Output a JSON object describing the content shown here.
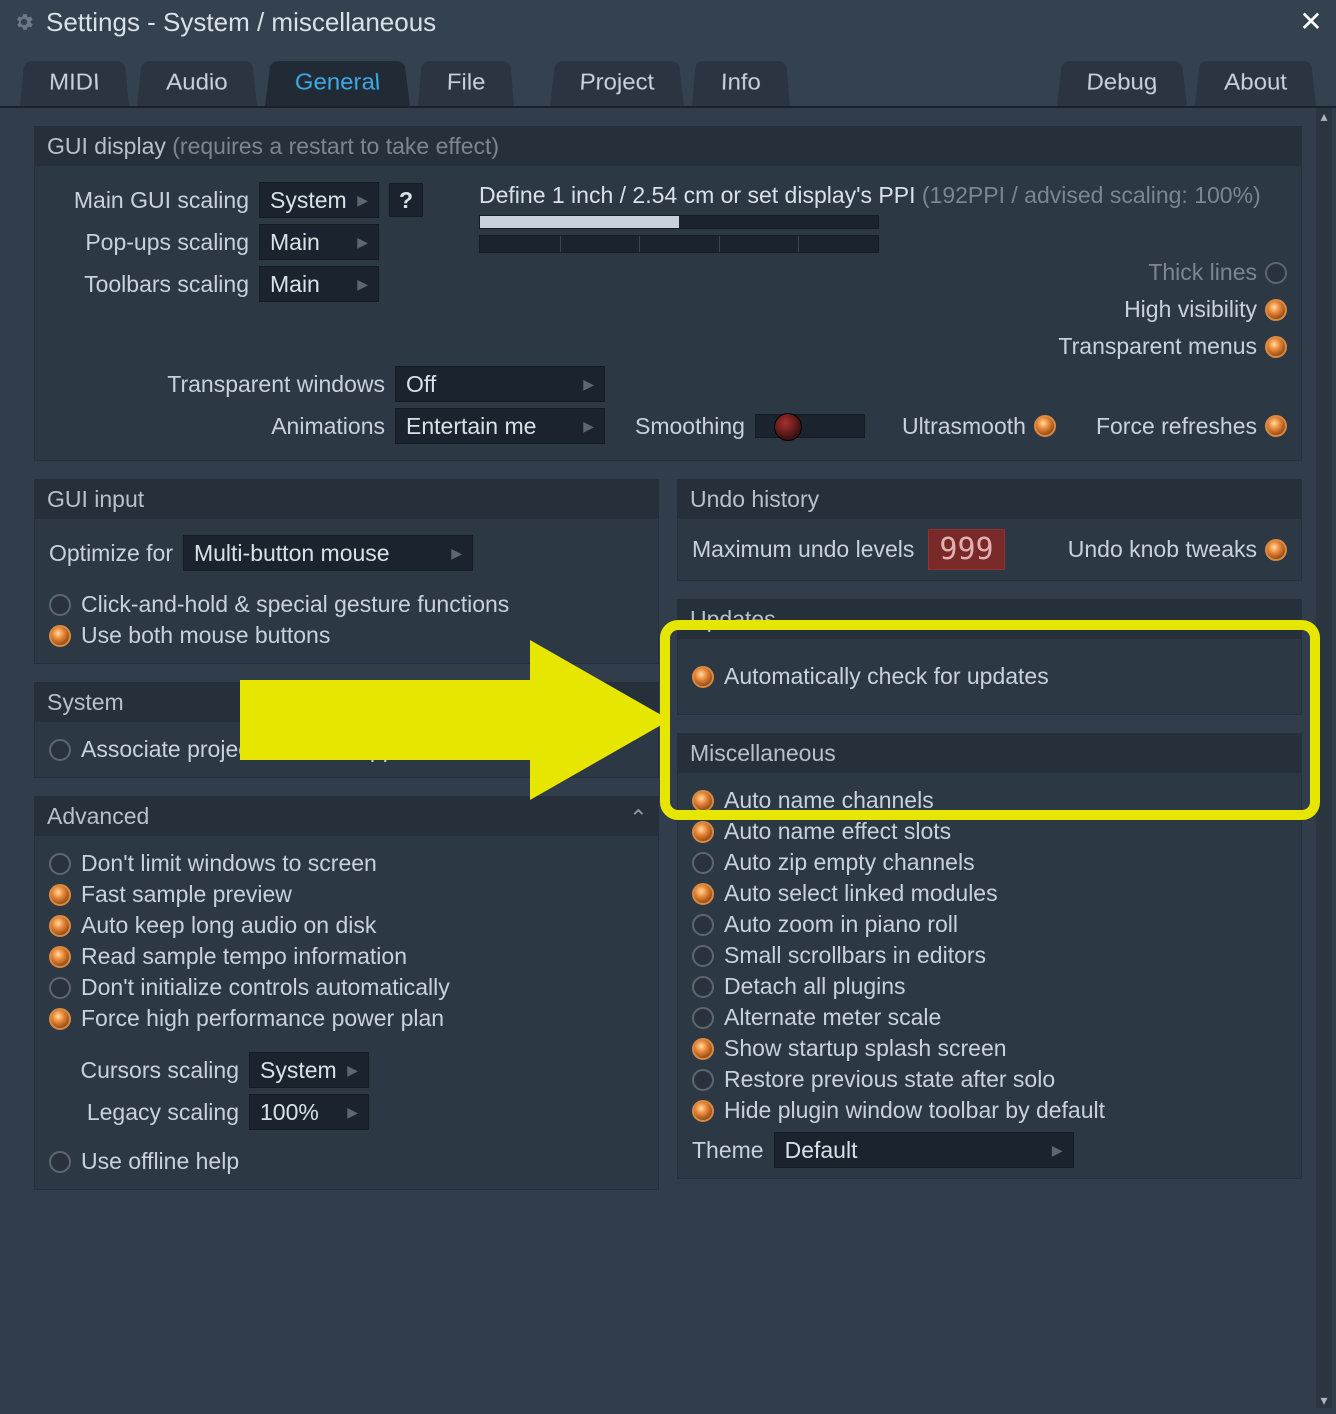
{
  "window": {
    "title": "Settings - System / miscellaneous"
  },
  "tabs": [
    "MIDI",
    "Audio",
    "General",
    "File",
    "Project",
    "Info",
    "Debug",
    "About"
  ],
  "active_tab": "General",
  "gui_display": {
    "title": "GUI display",
    "note": "(requires a restart to take effect)",
    "main_scaling_label": "Main GUI scaling",
    "main_scaling_value": "System",
    "help": "?",
    "define_text": "Define 1 inch / 2.54 cm or set display's PPI",
    "ppi_hint": "(192PPI / advised scaling: 100%)",
    "popups_label": "Pop-ups scaling",
    "popups_value": "Main",
    "toolbars_label": "Toolbars scaling",
    "toolbars_value": "Main",
    "transwin_label": "Transparent windows",
    "transwin_value": "Off",
    "anim_label": "Animations",
    "anim_value": "Entertain me",
    "smoothing_label": "Smoothing",
    "ultrasmooth_label": "Ultrasmooth",
    "force_refresh_label": "Force refreshes",
    "thick_lines_label": "Thick lines",
    "high_vis_label": "High visibility",
    "trans_menus_label": "Transparent menus"
  },
  "gui_input": {
    "title": "GUI input",
    "optimize_label": "Optimize for",
    "optimize_value": "Multi-button mouse",
    "opt1": "Click-and-hold & special gesture functions",
    "opt2": "Use both mouse buttons"
  },
  "system": {
    "title": "System",
    "opt1": "Associate project files with application"
  },
  "advanced": {
    "title": "Advanced",
    "opt1": "Don't limit windows to screen",
    "opt2": "Fast sample preview",
    "opt3": "Auto keep long audio on disk",
    "opt4": "Read sample tempo information",
    "opt5": "Don't initialize controls automatically",
    "opt6": "Force high performance power plan",
    "cursors_label": "Cursors scaling",
    "cursors_value": "System",
    "legacy_label": "Legacy scaling",
    "legacy_value": "100%",
    "offline_help": "Use offline help"
  },
  "undo": {
    "title": "Undo history",
    "max_label": "Maximum undo levels",
    "max_value": "999",
    "knob_label": "Undo knob tweaks"
  },
  "updates": {
    "title": "Updates",
    "opt1": "Automatically check for updates"
  },
  "misc": {
    "title": "Miscellaneous",
    "o1": "Auto name channels",
    "o2": "Auto name effect slots",
    "o3": "Auto zip empty channels",
    "o4": "Auto select linked modules",
    "o5": "Auto zoom in piano roll",
    "o6": "Small scrollbars in editors",
    "o7": "Detach all plugins",
    "o8": "Alternate meter scale",
    "o9": "Show startup splash screen",
    "o10": "Restore previous state after solo",
    "o11": "Hide plugin window toolbar by default",
    "theme_label": "Theme",
    "theme_value": "Default"
  }
}
